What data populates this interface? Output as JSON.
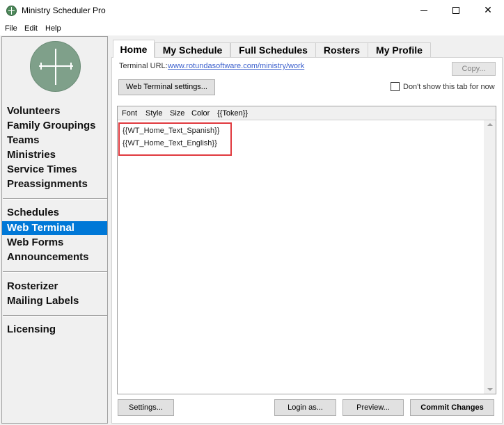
{
  "window": {
    "title": "Ministry Scheduler Pro",
    "icon": "app-compass-icon",
    "minimize_icon": "minimize-icon",
    "maximize_icon": "maximize-icon",
    "close_glyph": "✕"
  },
  "menu": {
    "items": [
      "File",
      "Edit",
      "Help"
    ]
  },
  "sidebar": {
    "logo_icon": "compass-logo-icon",
    "group1": [
      "Volunteers",
      "Family Groupings",
      "Teams",
      "Ministries",
      "Service Times",
      "Preassignments"
    ],
    "group2": [
      "Schedules",
      "Web Terminal",
      "Web Forms",
      "Announcements"
    ],
    "group3": [
      "Rosterizer",
      "Mailing Labels"
    ],
    "group4": [
      "Licensing"
    ],
    "selected": "Web Terminal",
    "selected_color": "#0078d7"
  },
  "tabs": {
    "items": [
      "Home",
      "My Schedule",
      "Full Schedules",
      "Rosters",
      "My Profile"
    ],
    "active": "Home"
  },
  "home": {
    "terminal_url_label": "Terminal URL:",
    "terminal_url": "www.rotundasoftware.com/ministry/work",
    "copy_button": "Copy...",
    "web_terminal_settings_button": "Web Terminal settings...",
    "dont_show_label": "Don't show this tab for now",
    "dont_show_checked": false
  },
  "editor": {
    "toolbar": [
      "Font",
      "Style",
      "Size",
      "Color",
      "{{Token}}"
    ],
    "lines": [
      "{{WT_Home_Text_Spanish}}",
      "{{WT_Home_Text_English}}"
    ],
    "highlight_color": "#e0393e"
  },
  "footer": {
    "settings_button": "Settings...",
    "login_as_button": "Login as...",
    "preview_button": "Preview...",
    "commit_button": "Commit Changes"
  }
}
